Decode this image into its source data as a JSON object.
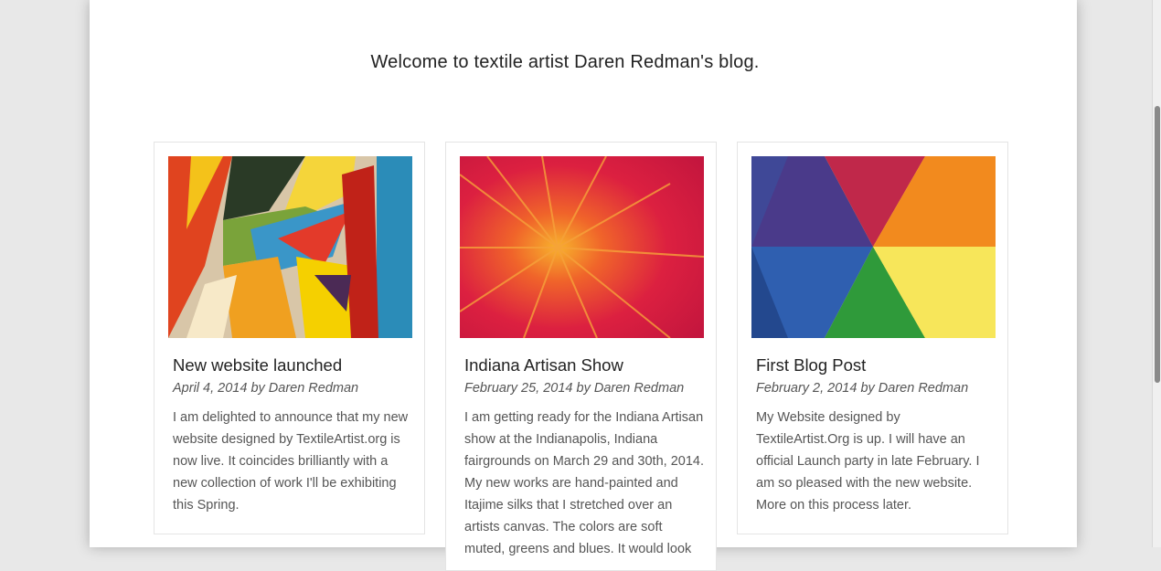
{
  "welcome": "Welcome to textile artist Daren Redman's blog.",
  "posts": [
    {
      "title": "New website launched",
      "meta": "April 4, 2014 by Daren Redman",
      "excerpt": "I am delighted to announce that my new website designed by TextileArtist.org is now live. It coincides brilliantly with a new collection of work I'll be exhibiting this Spring."
    },
    {
      "title": "Indiana Artisan Show",
      "meta": "February 25, 2014 by Daren Redman",
      "excerpt": "I am getting ready for the Indiana Artisan show at the Indianapolis, Indiana fairgrounds on March 29 and 30th, 2014. My new works are hand-painted and Itajime silks that I stretched over an artists canvas. The colors are soft muted, greens and blues. It would look"
    },
    {
      "title": "First Blog Post",
      "meta": "February 2, 2014 by Daren Redman",
      "excerpt": "My Website designed by TextileArtist.Org is up. I will have an official Launch party in late February. I am so pleased with the new website. More on this process later."
    }
  ]
}
